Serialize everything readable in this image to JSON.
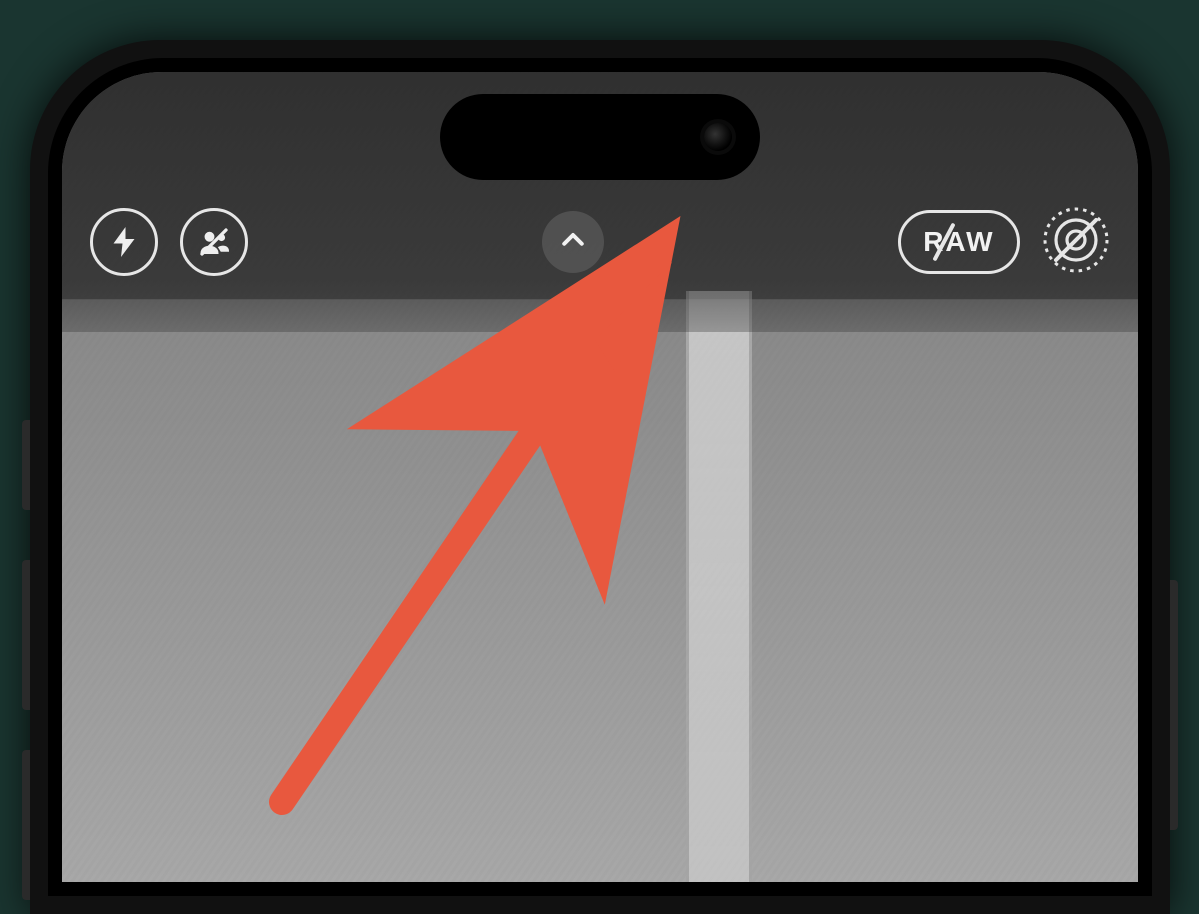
{
  "toolbar": {
    "flash_icon": "flash-icon",
    "person_icon": "shared-library-off-icon",
    "expand_icon": "chevron-up-icon",
    "raw_label": "RAW",
    "live_icon": "live-photo-off-icon"
  },
  "annotation": {
    "arrow_color": "#e8583e",
    "target": "camera-options-expand-button"
  }
}
